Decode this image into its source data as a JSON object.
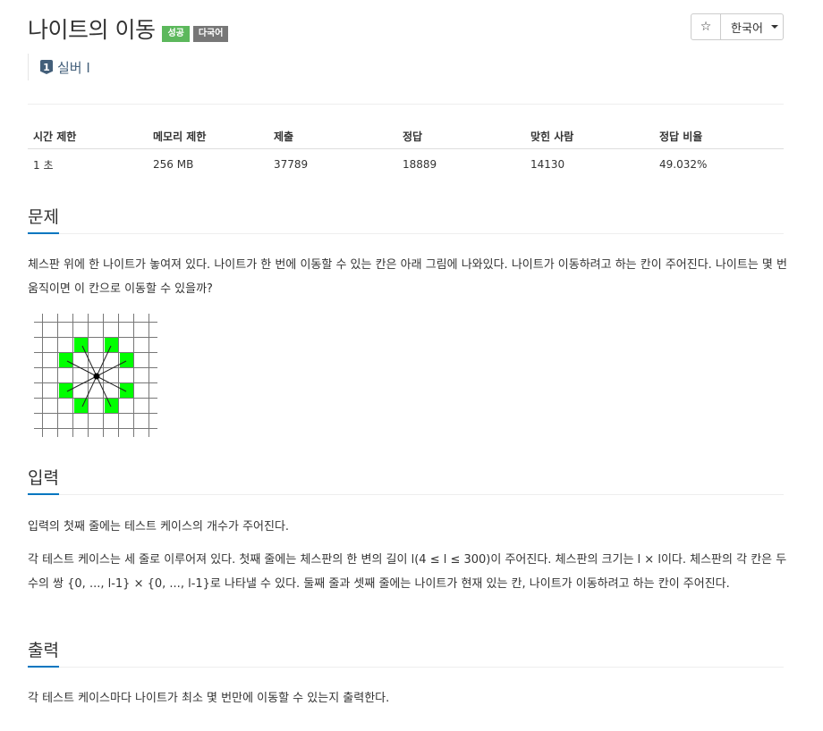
{
  "problem": {
    "title": "나이트의 이동",
    "badges": {
      "success": "성공",
      "multilang": "다국어"
    },
    "tier": {
      "icon_number": "1",
      "label": "실버 I"
    }
  },
  "toolbar": {
    "star_icon": "star-icon",
    "star_glyph": "☆",
    "language": "한국어"
  },
  "info_table": {
    "headers": [
      "시간 제한",
      "메모리 제한",
      "제출",
      "정답",
      "맞힌 사람",
      "정답 비율"
    ],
    "values": [
      "1 초",
      "256 MB",
      "37789",
      "18889",
      "14130",
      "49.032%"
    ]
  },
  "sections": {
    "problem": {
      "title": "문제",
      "text": "체스판 위에 한 나이트가 놓여져 있다. 나이트가 한 번에 이동할 수 있는 칸은 아래 그림에 나와있다. 나이트가 이동하려고 하는 칸이 주어진다. 나이트는 몇 번 움직이면 이 칸으로 이동할 수 있을까?"
    },
    "input": {
      "title": "입력",
      "text1": "입력의 첫째 줄에는 테스트 케이스의 개수가 주어진다.",
      "text2": "각 테스트 케이스는 세 줄로 이루어져 있다. 첫째 줄에는 체스판의 한 변의 길이 l(4 ≤ l ≤ 300)이 주어진다. 체스판의 크기는 l × l이다. 체스판의 각 칸은 두 수의 쌍 {0, ..., l-1} × {0, ..., l-1}로 나타낼 수 있다. 둘째 줄과 셋째 줄에는 나이트가 현재 있는 칸, 나이트가 이동하려고 하는 칸이 주어진다."
    },
    "output": {
      "title": "출력",
      "text": "각 테스트 케이스마다 나이트가 최소 몇 번만에 이동할 수 있는지 출력한다."
    }
  },
  "colors": {
    "accent": "#0076c0",
    "success": "#5cb85c",
    "multilang": "#777777",
    "tier": "#435f7a",
    "knight_target": "#00ff00"
  }
}
